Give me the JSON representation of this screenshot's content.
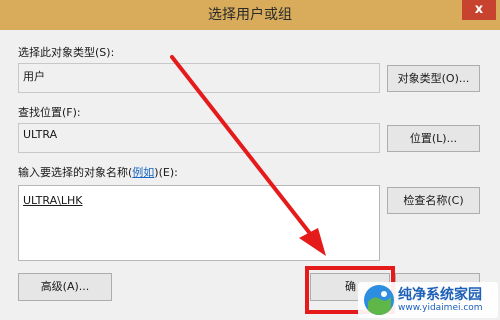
{
  "window": {
    "title": "选择用户或组",
    "close_glyph": "x"
  },
  "object_types": {
    "label": "选择此对象类型(S):",
    "value": "用户",
    "button_label": "对象类型(O)..."
  },
  "location": {
    "label": "查找位置(F):",
    "value": "ULTRA",
    "button_label": "位置(L)..."
  },
  "object_names": {
    "label_prefix": "输入要选择的对象名称(",
    "label_link": "例如",
    "label_suffix": ")(E):",
    "value": "ULTRA\\LHK",
    "check_button_label": "检查名称(C)"
  },
  "footer": {
    "advanced_button_label": "高级(A)...",
    "ok_button_label": "确"
  },
  "annotation": {
    "color": "#e51b1b"
  },
  "watermark": {
    "title": "纯净系统家园",
    "url": "www.yidaimei.com"
  }
}
